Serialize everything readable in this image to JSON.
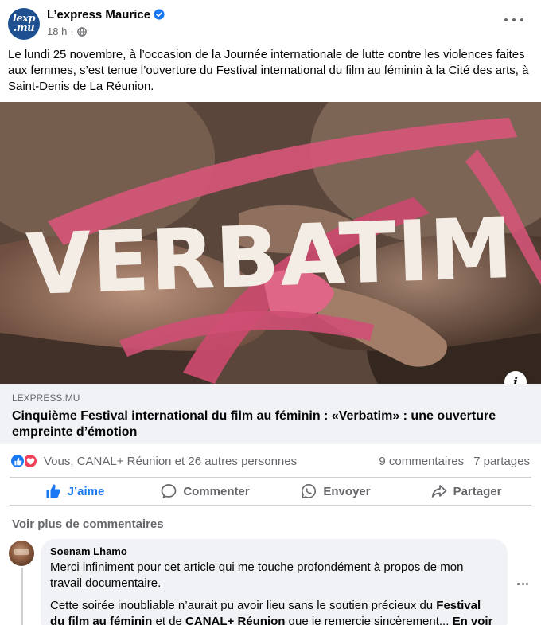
{
  "header": {
    "page_name": "L’express Maurice",
    "avatar_line1": "lexp",
    "avatar_line2": ".mu",
    "time": "18 h",
    "separator": "·"
  },
  "post": {
    "text": "Le lundi 25 novembre, à l’occasion de la Journée internationale de lutte contre les violences faites aux femmes, s’est tenue l’ouverture du Festival international du film au féminin à la Cité des arts, à Saint-Denis de La Réunion."
  },
  "image": {
    "overlay_text": "VERBATIM",
    "info_label": "i"
  },
  "link": {
    "domain": "LEXPRESS.MU",
    "title": "Cinquième Festival international du film au féminin : «Verbatim» : une ouverture empreinte d’émotion"
  },
  "reactions": {
    "summary": "Vous, CANAL+ Réunion et 26 autres personnes",
    "comments": "9 commentaires",
    "shares": "7 partages"
  },
  "actions": {
    "like": "J’aime",
    "comment": "Commenter",
    "send": "Envoyer",
    "share": "Partager"
  },
  "comments": {
    "see_more": "Voir plus de commentaires",
    "first": {
      "author": "Soenam Lhamo",
      "text1": "Merci infiniment pour cet article qui me touche profondément à propos de mon travail documentaire.",
      "text2_a": "Cette soirée inoubliable n’aurait pu avoir lieu sans le soutien précieux du ",
      "text2_b": "Festival du film au féminin",
      "text2_c": " et de ",
      "text2_d": "CANAL+ Réunion",
      "text2_e": " que je remercie sincèrement... ",
      "see_more": "En voir plus"
    }
  },
  "colors": {
    "brand_blue": "#1877f2",
    "love_red": "#f33e58",
    "secondary_text": "#65676b",
    "ribbon_pink": "#d8557a"
  }
}
